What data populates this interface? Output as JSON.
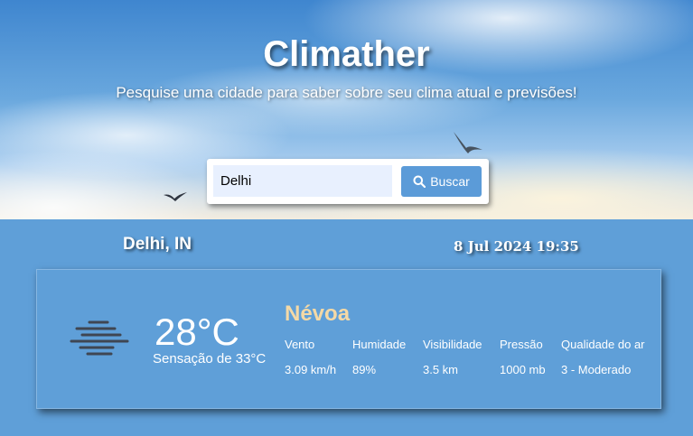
{
  "header": {
    "title": "Climather",
    "subtitle": "Pesquise uma cidade para saber sobre seu clima atual e previsões!"
  },
  "search": {
    "value": "Delhi",
    "button_label": "Buscar",
    "button_icon": "search-icon"
  },
  "location": {
    "city": "Delhi, IN",
    "datetime": "8 Jul 2024 19:35"
  },
  "weather": {
    "icon": "mist-icon",
    "temperature": "28°C",
    "feels_like": "Sensação de 33°C",
    "condition": "Névoa",
    "metrics": [
      {
        "label": "Vento",
        "value": "3.09 km/h"
      },
      {
        "label": "Humidade",
        "value": "89%"
      },
      {
        "label": "Visibilidade",
        "value": "3.5 km"
      },
      {
        "label": "Pressão",
        "value": "1000 mb"
      },
      {
        "label": "Qualidade do ar",
        "value": "3 - Moderado"
      }
    ]
  },
  "colors": {
    "background": "#5f9fd8",
    "button": "#5b9bd8",
    "condition_text": "#f4d9a6",
    "input_background": "#e8f0fe"
  }
}
